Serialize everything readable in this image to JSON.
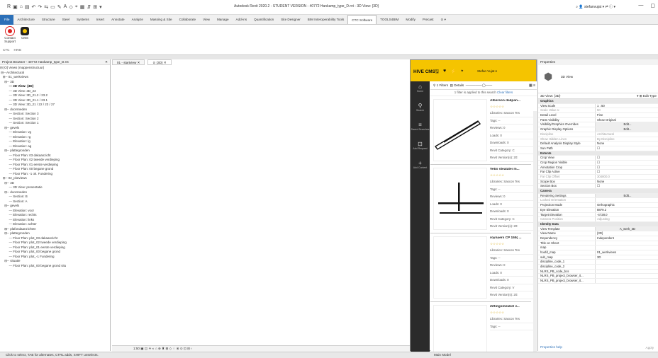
{
  "title": "Autodesk Revit 2020.2 - STUDENT VERSION - 40772 Hankamp_type_D.rvt - 3D View: {3D}",
  "user": "stefanvujat",
  "qat_icons": [
    "R",
    "▣",
    "⌂",
    "▤",
    "↶",
    "↷",
    "⇆",
    "▭",
    "✎",
    "A",
    "◇",
    "⌖",
    "▦",
    "⇵",
    "⊞",
    "▾"
  ],
  "tabs": [
    "File",
    "Architecture",
    "Structure",
    "Steel",
    "Systems",
    "Insert",
    "Annotate",
    "Analyze",
    "Massing & Site",
    "Collaborate",
    "View",
    "Manage",
    "Add-ins",
    "Quantification",
    "Site Designer",
    "BIM Interoperability Tools",
    "CTC Software",
    "TOOLS4BIM",
    "Modify",
    "Precast",
    "⊙ ▾"
  ],
  "active_tab": "CTC Software",
  "ribbon": {
    "contact": "Contact\nSupport",
    "cms": "CMS",
    "panels": [
      "CTC",
      "HIVE"
    ]
  },
  "project_browser": {
    "title": "Project Browser - 40772 Hankamp_type_D.rvt",
    "items": [
      "⊟ [O] Views (mappenstructuur)",
      " ⊟-- Architectural",
      "   ⊟-- 01_werkviews",
      "     ⊟-- 3D",
      "          --- 3D View: {3D}",
      "          --- 3D View: 3D_23",
      "          --- 3D View: 3D_21.2 / 23.2",
      "          --- 3D View: 3D_21.1 / 23.1",
      "          --- 3D View: 3D_21 / 22 / 23 / 27",
      "     ⊟-- doorsneden",
      "          --- Section: Section 3",
      "          --- Section: Section 2",
      "          --- Section: Section 1",
      "     ⊟-- gevels",
      "          --- Elevation: vg",
      "          --- Elevation: rg",
      "          --- Elevation: lg",
      "          --- Elevation: ag",
      "     ⊟-- plattegronden",
      "          --- Floor Plan: 03 dakaanzicht",
      "          --- Floor Plan: 02 tweede verdieping",
      "          --- Floor Plan: 01 eerste verdieping",
      "          --- Floor Plan: 00 begane grond",
      "          --- Floor Plan: -1 ok. Fundering",
      "   ⊟-- 02_plotviews",
      "     ⊟-- 3D",
      "          --- 3D View: presentatie",
      "     ⊟-- doorsneden",
      "          --- Section: B",
      "          --- Section: A",
      "     ⊟-- gevels",
      "          --- Elevation: voor",
      "          --- Elevation: rechts",
      "          --- Elevation: links",
      "          --- Elevation: achter",
      "     ⊞-- plafondaanzichten",
      "     ⊟-- plattegronden",
      "          --- Floor Plan: plot_03 dakaanzicht",
      "          --- Floor Plan: plot_02 tweede verdieping",
      "          --- Floor Plan: plot_01 eerste verdieping",
      "          --- Floor Plan: plot_00 begane grond",
      "          --- Floor Plan: plot_-1 Fundering",
      "     ⊟-- situatie",
      "          --- Floor Plan: plot_00 begane grond situ"
    ],
    "selected_index": 4
  },
  "view_tabs": [
    {
      "label": "01 - startview",
      "close": "✕"
    },
    {
      "label": "(3D)",
      "close": "✕"
    }
  ],
  "view_status": "1:50    ▣ ◫ ☀ ◐ ⌂ ⊕ ♜ ⊞ ◇ ♢ ⊗ ⊙ ⊡ ⊟ ‹",
  "hive": {
    "logo": "HIVE CMS",
    "header_icons": [
      "🖫",
      "♥",
      "⚡",
      "⭑"
    ],
    "user": "Stefan Vujat ▾",
    "side": [
      {
        "glyph": "⌂",
        "label": "Home"
      },
      {
        "glyph": "⚲",
        "label": "Search"
      },
      {
        "glyph": "≡",
        "label": "Saved Searches"
      },
      {
        "glyph": "⊡",
        "label": "Add Request"
      },
      {
        "glyph": "+",
        "label": "Add Content"
      }
    ],
    "toolbar": {
      "filters": "1 Filters",
      "details": "Details",
      "view": "▦ ≡"
    },
    "filter_info": "1 filter is applied to this search",
    "clear": "Clear filters",
    "cards": [
      {
        "name": "Alberson dakpan...",
        "stars": "☆☆☆☆☆",
        "lib": "Libraries: Sascon Tes",
        "tags": "Tags: --",
        "reviews": "Reviews: 0",
        "loads": "Loads: 0",
        "downloads": "Downloads: 0",
        "cat": "Revit Category: C",
        "ver": "Revit Version(s): 20:"
      },
      {
        "name": "Vebo stealatei m...",
        "stars": "☆☆☆☆☆",
        "lib": "Libraries: Sascon Tes",
        "tags": "Tags: --",
        "reviews": "Reviews: 0",
        "loads": "Loads: 0",
        "downloads": "Downloads: 0",
        "cat": "Revit Category: C",
        "ver": "Revit Version(s): 20:"
      },
      {
        "name": "roynaers CP 155( ...",
        "stars": "☆☆☆☆☆",
        "lib": "Libraries: Sascon Tes",
        "tags": "Tags: --",
        "reviews": "Reviews: 0",
        "loads": "Loads: 0",
        "downloads": "Downloads: 0",
        "cat": "Revit Category: V",
        "ver": "Revit Version(s): 20:"
      },
      {
        "name": "Zittingsmeubel v...",
        "stars": "☆☆☆☆☆",
        "lib": "Libraries: Sascon Tes",
        "tags": "Tags: --"
      }
    ]
  },
  "properties": {
    "title": "Properties",
    "type": "3D View",
    "selector": "3D View: {3D}",
    "edit_type": "Edit Type",
    "rows": [
      {
        "g": 1,
        "k": "Graphics"
      },
      {
        "k": "View Scale",
        "v": "1 : 50"
      },
      {
        "k": "Scale Value  1:",
        "v": "50",
        "d": 1
      },
      {
        "k": "Detail Level",
        "v": "Fine"
      },
      {
        "k": "Parts Visibility",
        "v": "Show Original"
      },
      {
        "k": "Visibility/Graphics Overrides",
        "v": "Edit...",
        "b": 1
      },
      {
        "k": "Graphic Display Options",
        "v": "Edit...",
        "b": 1
      },
      {
        "k": "Discipline",
        "v": "Architectural",
        "d": 1
      },
      {
        "k": "Show Hidden Lines",
        "v": "By Discipline",
        "d": 1
      },
      {
        "k": "Default Analysis Display Style",
        "v": "None"
      },
      {
        "k": "Sun Path",
        "v": "☐"
      },
      {
        "g": 1,
        "k": "Extents"
      },
      {
        "k": "Crop View",
        "v": "☐"
      },
      {
        "k": "Crop Region Visible",
        "v": "☐"
      },
      {
        "k": "Annotation Crop",
        "v": "☐"
      },
      {
        "k": "Far Clip Active",
        "v": "☐"
      },
      {
        "k": "Far Clip Offset",
        "v": "304800.0",
        "d": 1
      },
      {
        "k": "Scope Box",
        "v": "None"
      },
      {
        "k": "Section Box",
        "v": "☐"
      },
      {
        "g": 1,
        "k": "Camera"
      },
      {
        "k": "Rendering Settings",
        "v": "Edit...",
        "b": 1
      },
      {
        "k": "Locked Orientation",
        "v": "",
        "d": 1
      },
      {
        "k": "Projection Mode",
        "v": "Orthographic"
      },
      {
        "k": "Eye Elevation",
        "v": "8879.2"
      },
      {
        "k": "Target Elevation",
        "v": "-4728.0"
      },
      {
        "k": "Camera Position",
        "v": "Adjusting",
        "d": 1
      },
      {
        "g": 1,
        "k": "Identity Data"
      },
      {
        "k": "View Template",
        "v": "A_werk_3D",
        "b": 1
      },
      {
        "k": "View Name",
        "v": "{3D}"
      },
      {
        "k": "Dependency",
        "v": "Independent"
      },
      {
        "k": "Title on Sheet",
        "v": ""
      },
      {
        "k": "map",
        "v": ""
      },
      {
        "k": "hoofd_map",
        "v": "01_werkviews"
      },
      {
        "k": "sub_map",
        "v": "3D"
      },
      {
        "k": "discipline_code_1",
        "v": ""
      },
      {
        "k": "discipline_code_2",
        "v": ""
      },
      {
        "k": "NLRS_PB_code_bcs",
        "v": ""
      },
      {
        "k": "NLRS_PB_project_browser_it...",
        "v": ""
      },
      {
        "k": "NLRS_PB_project_browser_it...",
        "v": ""
      }
    ],
    "help": "Properties help",
    "apply": "Apply"
  },
  "status": {
    "msg": "Click to select, TAB for alternates, CTRL adds, SHIFT unselects.",
    "model": "Main Model"
  }
}
